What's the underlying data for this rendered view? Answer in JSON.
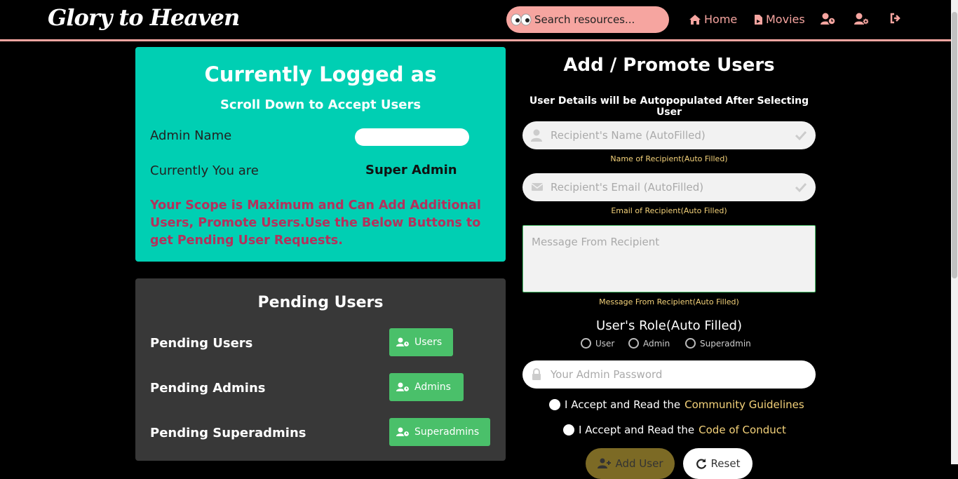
{
  "header": {
    "brand": "Glory to Heaven",
    "search_placeholder": "Search resources...",
    "nav": {
      "home": "Home",
      "movies": "Movies"
    }
  },
  "current_user": {
    "title": "Currently Logged as",
    "subtitle": "Scroll Down to Accept Users",
    "admin_name_label": "Admin Name",
    "role_label": "Currently You are",
    "role_value": "Super Admin",
    "scope_message": "Your Scope is Maximum and Can Add Additional Users, Promote Users.Use the Below Buttons to get Pending User Requests."
  },
  "pending": {
    "title": "Pending Users",
    "rows": [
      {
        "label": "Pending Users",
        "button": "Users"
      },
      {
        "label": "Pending Admins",
        "button": "Admins"
      },
      {
        "label": "Pending Superadmins",
        "button": "Superadmins"
      }
    ]
  },
  "form": {
    "title": "Add / Promote Users",
    "subtitle": "User Details will be Autopopulated After Selecting User",
    "name_placeholder": "Recipient's Name (AutoFilled)",
    "name_hint": "Name of Recipient(Auto Filled)",
    "email_placeholder": "Recipient's Email (AutoFilled)",
    "email_hint": "Email of Recipient(Auto Filled)",
    "message_placeholder": "Message From Recipient",
    "message_hint": "Message From Recipient(Auto Filled)",
    "role_title": "User's Role(Auto Filled)",
    "roles": [
      "User",
      "Admin",
      "Superadmin"
    ],
    "password_placeholder": "Your Admin Password",
    "accept_prefix": "I Accept and Read the",
    "guidelines_link": "Community Guidelines",
    "conduct_link": "Code of Conduct",
    "add_button": "Add User",
    "reset_button": "Reset"
  }
}
